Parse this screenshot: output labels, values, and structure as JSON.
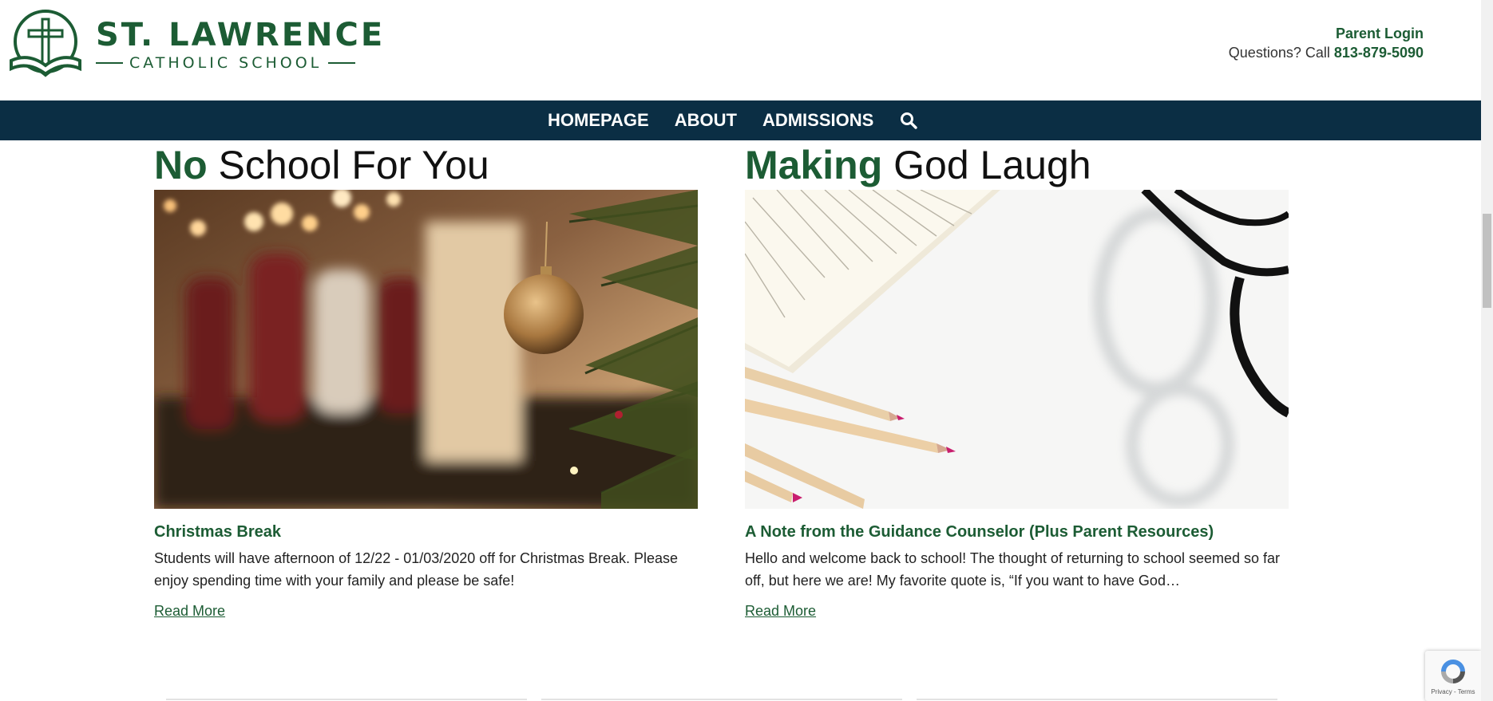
{
  "header": {
    "logo_name": "ST. LAWRENCE",
    "logo_sub": "CATHOLIC SCHOOL",
    "parent_login": "Parent Login",
    "questions_label": "Questions? Call",
    "phone": "813-879-5090"
  },
  "nav": {
    "items": [
      "HOMEPAGE",
      "ABOUT",
      "ADMISSIONS"
    ],
    "search_icon": "search-icon"
  },
  "posts": [
    {
      "heading_accent": "No",
      "heading_rest": " School For You",
      "title": "Christmas Break",
      "excerpt": "Students will have afternoon of 12/22 - 01/03/2020 off for Christmas Break. Please enjoy spending time with your family and please be safe!",
      "read_more": "Read More"
    },
    {
      "heading_accent": "Making",
      "heading_rest": " God Laugh",
      "title": "A Note from the Guidance Counselor (Plus Parent Resources)",
      "excerpt": "Hello and welcome back to school!  The thought of returning to school seemed so far off, but here we are!  My favorite quote is, “If you want to have God…",
      "read_more": "Read More"
    }
  ],
  "recaptcha": {
    "links": "Privacy - Terms"
  },
  "colors": {
    "brand_green": "#1c5c34",
    "nav_navy": "#0b2e44"
  }
}
